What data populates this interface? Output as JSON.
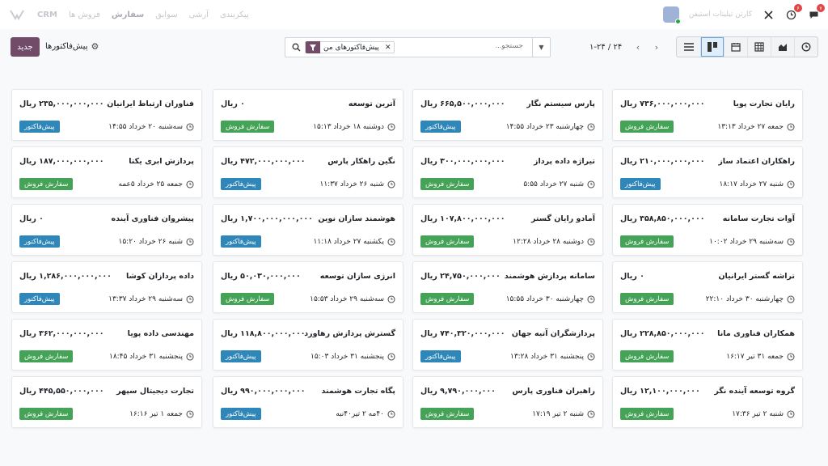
{
  "navbar": {
    "app_name": "CRM",
    "menus": [
      "فروش ها",
      "سفارش",
      "سوابق",
      "آرشی",
      "پیکربندی"
    ],
    "company": "کارتن تیلیتات استیفن",
    "chat_badge": "۷",
    "activity_badge": "۶",
    "colors": {
      "badge": "#e04646",
      "avatar": "#9eb3d6",
      "online": "#28a745"
    }
  },
  "control": {
    "new_label": "جدید",
    "breadcrumb": "پیش‌فاکتورها",
    "search_placeholder": "جستجو...",
    "facet_label": "پیش‌فاکتورهای من",
    "pager_range": "۱-۲۴",
    "pager_sep": "/",
    "pager_total": "۲۴",
    "views": [
      "activity-icon",
      "graph-icon",
      "pivot-icon",
      "calendar-icon",
      "kanban-icon",
      "list-icon"
    ],
    "active_view": "kanban-icon",
    "colors": {
      "primary": "#714b67",
      "active_view": "#e0eefc"
    }
  },
  "statuses": {
    "quote": {
      "label": "پیش‌فاکتور",
      "color": "#2f86b8"
    },
    "order": {
      "label": "سفارش فروش",
      "color": "#44a356"
    }
  },
  "cards": [
    {
      "name": "رایان تجارت پویا",
      "amount": "۷۳۶,۰۰۰,۰۰۰,۰۰۰ ریال",
      "date": "جمعه ۲۷ خرداد ۱۳:۱۳",
      "status": "order"
    },
    {
      "name": "پارس سیستم نگار",
      "amount": "۶۶۵,۵۰۰,۰۰۰,۰۰۰ ریال",
      "date": "چهارشنبه ۲۳ خرداد ۱۴:۵۵",
      "status": "quote"
    },
    {
      "name": "آترین توسعه",
      "amount": "۰ ریال",
      "date": "دوشنبه ۱۸ خرداد ۱۵:۱۳",
      "status": "order"
    },
    {
      "name": "فناوران ارتباط ایرانیان",
      "amount": "۲۳۵,۰۰۰,۰۰۰,۰۰۰ ریال",
      "date": "سه‌شنبه ۲۰ خرداد ۱۴:۵۵",
      "status": "quote"
    },
    {
      "name": "راهکاران اعتماد ساز",
      "amount": "۲۱۰,۰۰۰,۰۰۰,۰۰۰ ریال",
      "date": "شنبه ۲۷ خرداد ۱۸:۱۷",
      "status": "quote"
    },
    {
      "name": "تیراژه داده پرداز",
      "amount": "۳۰۰,۰۰۰,۰۰۰,۰۰۰ ریال",
      "date": "شنبه ۲۷ خرداد ۵:۵۵",
      "status": "order"
    },
    {
      "name": "نگین راهکار پارس",
      "amount": "۴۷۲,۰۰۰,۰۰۰,۰۰۰ ریال",
      "date": "شنبه ۲۶ خرداد ۱۱:۳۷",
      "status": "quote"
    },
    {
      "name": "پردازش ابری یکتا",
      "amount": "۱۸۷,۰۰۰,۰۰۰,۰۰۰ ریال",
      "date": "جمعه ۲۵ خرداد ۵عمه",
      "status": "order"
    },
    {
      "name": "آوات تجارت سامانه",
      "amount": "۳۵۸,۸۵۰,۰۰۰,۰۰۰ ریال",
      "date": "سه‌شنبه ۲۹ خرداد ۱۰:۰۲",
      "status": "order"
    },
    {
      "name": "آمادو رایان گستر",
      "amount": "۱۰۷,۸۰۰,۰۰۰,۰۰۰ ریال",
      "date": "دوشنبه ۲۸ خرداد ۱۲:۲۸",
      "status": "order"
    },
    {
      "name": "هوشمند سازان نوین",
      "amount": "۱,۷۰۰,۰۰۰,۰۰۰,۰۰۰ ریال",
      "date": "یکشنبه ۲۷ خرداد ۱۱:۱۸",
      "status": "quote"
    },
    {
      "name": "پیشروان فناوری آینده",
      "amount": "۰ ریال",
      "date": "شنبه ۲۶ خرداد ۱۵:۲۰",
      "status": "quote"
    },
    {
      "name": "تراشه گستر ایرانیان",
      "amount": "۰ ریال",
      "date": "چهارشنبه ۳۰ خرداد ۲۲:۱۰",
      "status": "order"
    },
    {
      "name": "سامانه پردازش هوشمند",
      "amount": "۲۴,۷۵۰,۰۰۰,۰۰۰ ریال",
      "date": "چهارشنبه ۳۰ خرداد ۱۵:۵۵",
      "status": "order"
    },
    {
      "name": "انرژی سازان توسعه",
      "amount": "۵۰,۰۳۰,۰۰۰,۰۰۰ ریال",
      "date": "سه‌شنبه ۲۹ خرداد ۱۵:۵۳",
      "status": "order"
    },
    {
      "name": "داده پردازان کوشا",
      "amount": "۱,۲۸۶,۰۰۰,۰۰۰,۰۰۰ ریال",
      "date": "سه‌شنبه ۲۹ خرداد ۱۳:۳۷",
      "status": "quote"
    },
    {
      "name": "همکاران فناوری مانا",
      "amount": "۲۲۸,۸۵۰,۰۰۰,۰۰۰ ریال",
      "date": "جمعه ۳۱ تیر ۱۶:۱۷",
      "status": "order"
    },
    {
      "name": "پردازشگران آتیه جهان",
      "amount": "۷۴۰,۳۲۰,۰۰۰,۰۰۰ ریال",
      "date": "پنجشنبه ۳۱ خرداد ۱۳:۲۸",
      "status": "quote"
    },
    {
      "name": "گسترش پردازش رهاورد",
      "amount": "۱۱۸,۸۰۰,۰۰۰,۰۰۰ ریال",
      "date": "پنجشنبه ۳۱ خرداد ۱۵:۰۳",
      "status": "quote"
    },
    {
      "name": "مهندسی داده پویا",
      "amount": "۳۶۲,۰۰۰,۰۰۰,۰۰۰ ریال",
      "date": "پنجشنبه ۳۱ خرداد ۱۸:۴۵",
      "status": "order"
    },
    {
      "name": "گروه توسعه آینده نگر",
      "amount": "۱۲,۱۰۰,۰۰۰,۰۰۰ ریال",
      "date": "شنبه ۲ تیر ۱۷:۳۶",
      "status": "order"
    },
    {
      "name": "راهبران فناوری پارس",
      "amount": "۹,۷۹۰,۰۰۰,۰۰۰ ریال",
      "date": "شنبه ۲ تیر ۱۷:۱۹",
      "status": "order"
    },
    {
      "name": "پگاه تجارت هوشمند",
      "amount": "۹۹۰,۰۰۰,۰۰۰,۰۰۰ ریال",
      "date": "۴۰مه ۲ تیر۴۰نبه",
      "status": "quote"
    },
    {
      "name": "تجارت دیجیتال سپهر",
      "amount": "۴۴۵,۵۵۰,۰۰۰,۰۰۰ ریال",
      "date": "جمعه ۱ تیر ۱۶:۱۶",
      "status": "order"
    }
  ]
}
